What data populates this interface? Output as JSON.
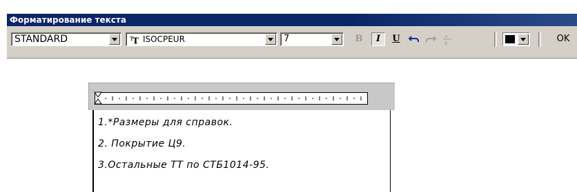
{
  "window": {
    "title": "Форматирование текста"
  },
  "toolbar": {
    "style_value": "STANDARD",
    "font_value": "ISOCPEUR",
    "font_icon": "truetype-font-icon",
    "size_value": "7",
    "bold_label": "B",
    "italic_label": "I",
    "underline_label": "U",
    "undo_icon": "undo-icon",
    "redo_icon": "redo-icon",
    "stack_icon": "stack-fraction-icon",
    "color": "#000000",
    "ok_label": "OK"
  },
  "editor": {
    "lines": [
      "1.*Размеры для справок.",
      "2.  Покрытие Ц9.",
      "3.Остальные ТТ по СТБ1014-95."
    ]
  }
}
